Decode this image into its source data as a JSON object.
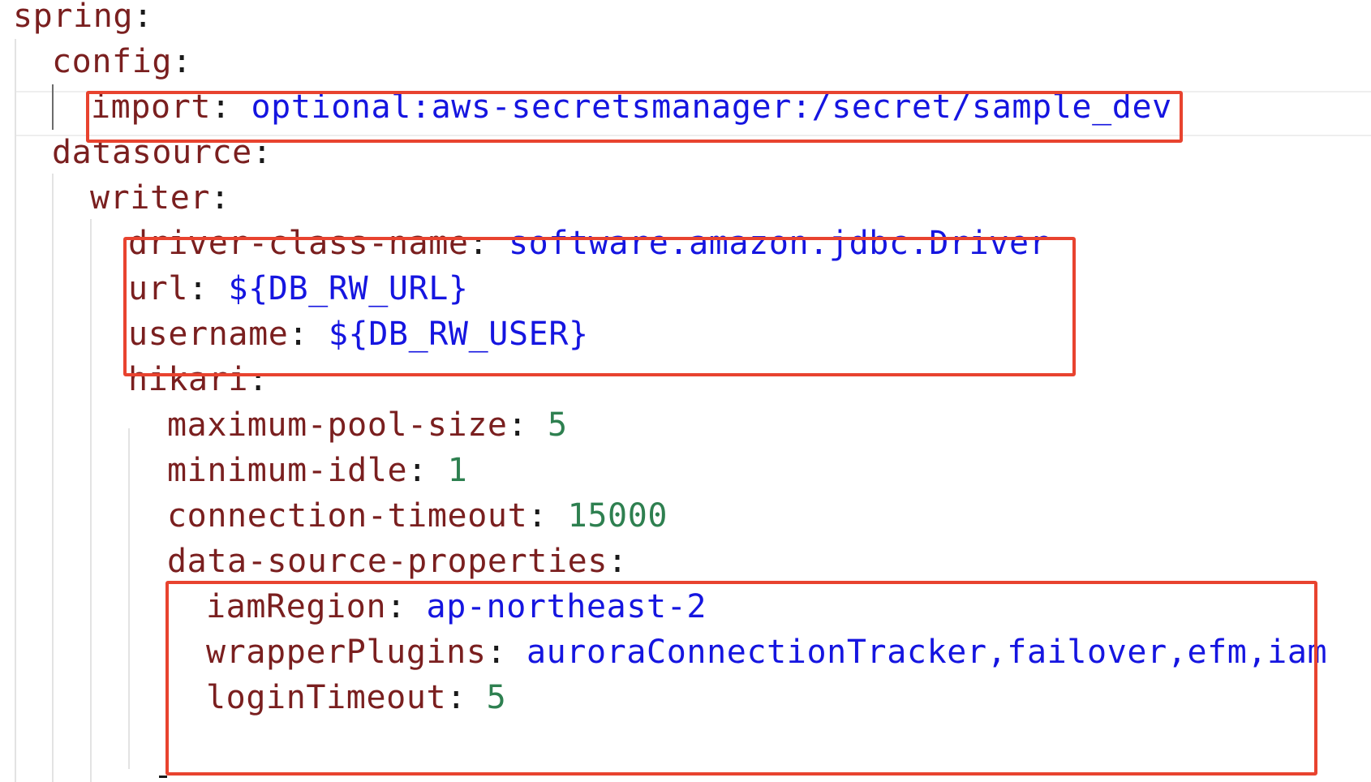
{
  "editor": {
    "language": "yaml",
    "colors": {
      "key": "#7a1f1f",
      "string": "#1515e0",
      "number": "#2e8050",
      "punctuation": "#1a1a1a",
      "highlight_box": "#e8432f",
      "indent_guide": "#e3e3e3"
    },
    "lines": [
      {
        "key": "spring",
        "value": ""
      },
      {
        "key": "config",
        "value": ""
      },
      {
        "key": "import",
        "value": "optional:aws-secretsmanager:/secret/sample_dev"
      },
      {
        "key": "datasource",
        "value": ""
      },
      {
        "key": "writer",
        "value": ""
      },
      {
        "key": "driver-class-name",
        "value": "software.amazon.jdbc.Driver"
      },
      {
        "key": "url",
        "value": "${DB_RW_URL}"
      },
      {
        "key": "username",
        "value": "${DB_RW_USER}"
      },
      {
        "key": "hikari",
        "value": ""
      },
      {
        "key": "maximum-pool-size",
        "value": "5"
      },
      {
        "key": "minimum-idle",
        "value": "1"
      },
      {
        "key": "connection-timeout",
        "value": "15000"
      },
      {
        "key": "data-source-properties",
        "value": ""
      },
      {
        "key": "iamRegion",
        "value": "ap-northeast-2"
      },
      {
        "key": "wrapperPlugins",
        "value": "auroraConnectionTracker,failover,efm,iam"
      },
      {
        "key": "loginTimeout",
        "value": "5"
      }
    ]
  }
}
